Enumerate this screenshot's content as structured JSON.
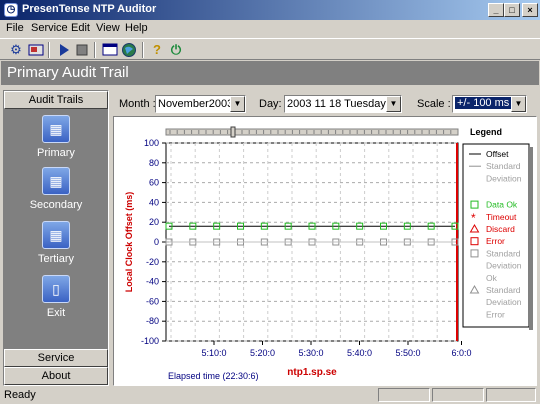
{
  "window": {
    "title": "PresenTense NTP Auditor",
    "minimize": "_",
    "maximize": "□",
    "close": "×"
  },
  "menu": [
    "File",
    "Service",
    "Edit",
    "View",
    "Help"
  ],
  "header": {
    "title": "Primary Audit Trail"
  },
  "left_panel": {
    "section_title": "Audit Trails",
    "items": [
      {
        "label": "Primary",
        "icon": "primary-trail-icon"
      },
      {
        "label": "Secondary",
        "icon": "secondary-trail-icon"
      },
      {
        "label": "Tertiary",
        "icon": "tertiary-trail-icon"
      },
      {
        "label": "Exit",
        "icon": "exit-door-icon"
      }
    ],
    "service_label": "Service",
    "about_label": "About"
  },
  "controls": {
    "month_label": "Month :",
    "month_value": "November2003",
    "day_label": "Day:",
    "day_value": "2003 11 18 Tuesday",
    "scale_label": "Scale :",
    "scale_value": "+/- 100 ms"
  },
  "status": {
    "text": "Ready"
  },
  "chart_data": {
    "type": "line",
    "ylabel": "Local Clock Offset (ms)",
    "xlabel": "Elapsed time (22:30:6)",
    "server": "ntp1.sp.se",
    "ylim": [
      -100,
      100
    ],
    "y_ticks": [
      "100",
      "80",
      "60",
      "40",
      "20",
      "0",
      "-20",
      "-40",
      "-60",
      "-80",
      "-100"
    ],
    "x_ticks": [
      "5:10:0",
      "5:20:0",
      "5:30:0",
      "5:40:0",
      "5:50:0",
      "6:0:0"
    ],
    "grid": true,
    "legend_position": "right",
    "legend": {
      "title": "Legend",
      "entries": [
        {
          "label": "Offset",
          "color": "#000000",
          "marker": "line"
        },
        {
          "label": "Standard Deviation",
          "color": "#909090",
          "marker": "line"
        },
        {
          "label": "Data Ok",
          "color": "#22bb22",
          "marker": "square"
        },
        {
          "label": "Timeout",
          "color": "#dd0000",
          "marker": "asterisk"
        },
        {
          "label": "Discard",
          "color": "#dd0000",
          "marker": "triangle"
        },
        {
          "label": "Error",
          "color": "#dd0000",
          "marker": "square"
        },
        {
          "label": "Standard Deviation Ok",
          "color": "#909090",
          "marker": "square"
        },
        {
          "label": "Standard Deviation Error",
          "color": "#909090",
          "marker": "triangle"
        }
      ]
    },
    "series": [
      {
        "name": "Offset",
        "color": "#000000",
        "values": [
          16,
          16,
          16,
          16,
          16,
          16,
          16,
          16,
          16,
          16,
          16,
          16,
          16
        ]
      },
      {
        "name": "Data Ok",
        "color": "#22bb22",
        "values": [
          16,
          16,
          16,
          16,
          16,
          16,
          16,
          16,
          16,
          16,
          16,
          16,
          16
        ]
      },
      {
        "name": "Standard Deviation Ok",
        "color": "#909090",
        "values": [
          0,
          0,
          0,
          0,
          0,
          0,
          0,
          0,
          0,
          0,
          0,
          0,
          0
        ]
      }
    ]
  }
}
